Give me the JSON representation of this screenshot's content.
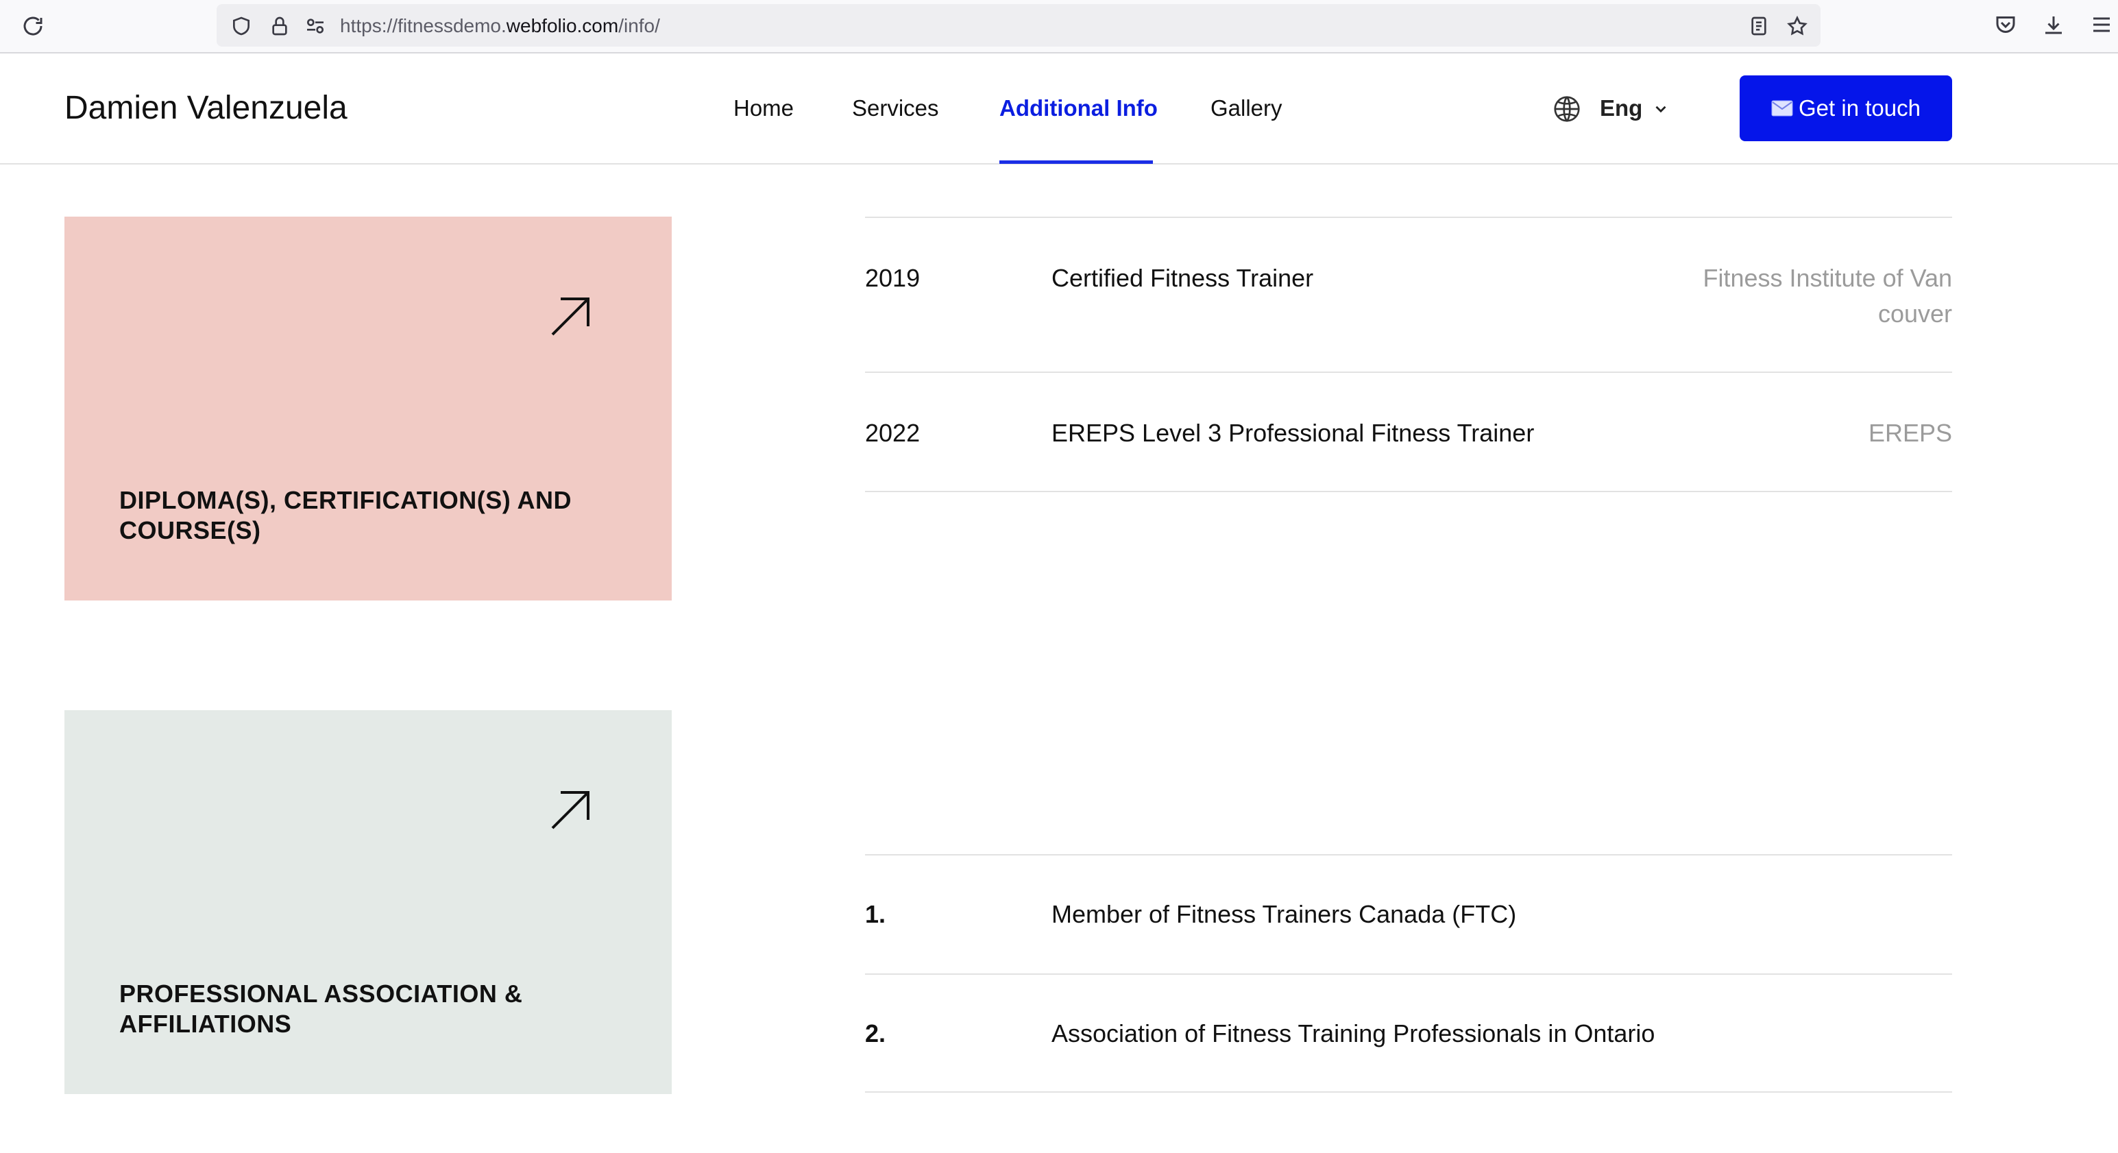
{
  "browser": {
    "url_prefix": "https://fitnessdemo.",
    "url_host": "webfolio.com",
    "url_path": "/info/"
  },
  "header": {
    "brand": "Damien Valenzuela",
    "nav": [
      {
        "label": "Home"
      },
      {
        "label": "Services"
      },
      {
        "label": "Additional Info"
      },
      {
        "label": "Gallery"
      }
    ],
    "language": "Eng",
    "cta_label": "Get in touch"
  },
  "cards": {
    "diplomas": {
      "title": "DIPLOMA(S), CERTIFICATION(S) AND COURSE(S)"
    },
    "associations": {
      "title": "PROFESSIONAL ASSOCIATION & AFFILIATIONS"
    }
  },
  "certifications": [
    {
      "year": "2019",
      "name": "Certified Fitness Trainer",
      "org": "Fitness Institute of Vancouver"
    },
    {
      "year": "2022",
      "name": "EREPS Level 3 Professional Fitness Trainer",
      "org": "EREPS"
    }
  ],
  "associations": [
    {
      "number": "1.",
      "name": "Member of Fitness Trainers Canada (FTC)"
    },
    {
      "number": "2.",
      "name": "Association of Fitness Training Professionals in Ontario"
    }
  ],
  "colors": {
    "accent": "#0515ea",
    "active_nav": "#0b1ee0",
    "card_pink": "#f1cbc5",
    "card_grey": "#e4eae7",
    "muted_text": "#9b9b9b"
  }
}
